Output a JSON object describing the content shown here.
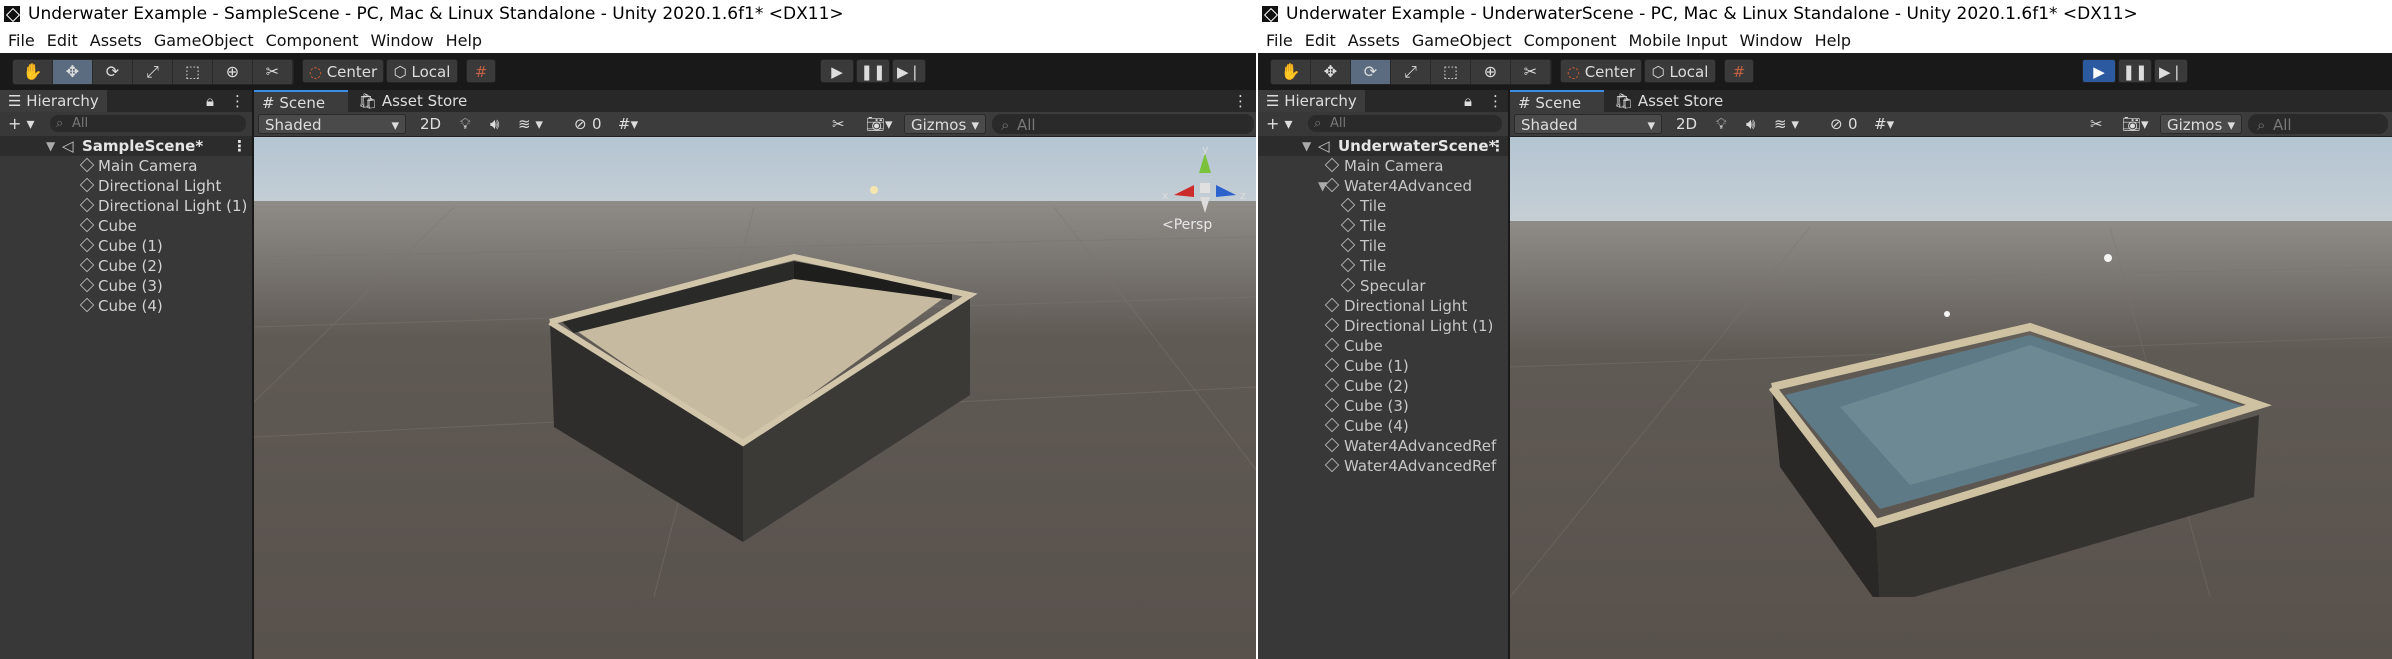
{
  "left": {
    "title": "Underwater Example - SampleScene - PC, Mac & Linux Standalone - Unity 2020.1.6f1* <DX11>",
    "menu": [
      "File",
      "Edit",
      "Assets",
      "GameObject",
      "Component",
      "Window",
      "Help"
    ],
    "toolbar": {
      "center": "Center",
      "local": "Local"
    },
    "hierarchy": {
      "tab": "Hierarchy",
      "search_placeholder": "All",
      "scene": "SampleScene*",
      "items": [
        "Main Camera",
        "Directional Light",
        "Directional Light (1)",
        "Cube",
        "Cube (1)",
        "Cube (2)",
        "Cube (3)",
        "Cube (4)"
      ]
    },
    "scene": {
      "tabs": [
        "Scene",
        "Asset Store"
      ],
      "shading": "Shaded",
      "mode2d": "2D",
      "fx_count": "0",
      "gizmos": "Gizmos",
      "search_placeholder": "All",
      "persp": "<Persp",
      "axes": {
        "x": "x",
        "y": "y",
        "z": "z"
      }
    }
  },
  "right": {
    "title": "Underwater Example - UnderwaterScene - PC, Mac & Linux Standalone - Unity 2020.1.6f1* <DX11>",
    "menu": [
      "File",
      "Edit",
      "Assets",
      "GameObject",
      "Component",
      "Mobile Input",
      "Window",
      "Help"
    ],
    "toolbar": {
      "center": "Center",
      "local": "Local"
    },
    "hierarchy": {
      "tab": "Hierarchy",
      "search_placeholder": "All",
      "scene": "UnderwaterScene*",
      "items": [
        "Main Camera",
        "Water4Advanced",
        "Tile",
        "Tile",
        "Tile",
        "Tile",
        "Specular",
        "Directional Light",
        "Directional Light (1)",
        "Cube",
        "Cube (1)",
        "Cube (2)",
        "Cube (3)",
        "Cube (4)",
        "Water4AdvancedRef",
        "Water4AdvancedRef"
      ]
    },
    "scene": {
      "tabs": [
        "Scene",
        "Asset Store"
      ],
      "shading": "Shaded",
      "mode2d": "2D",
      "fx_count": "0",
      "gizmos": "Gizmos",
      "search_placeholder": "All"
    }
  },
  "colors": {
    "accent": "#3a8ee6",
    "play_active": "#2b5aa0"
  }
}
